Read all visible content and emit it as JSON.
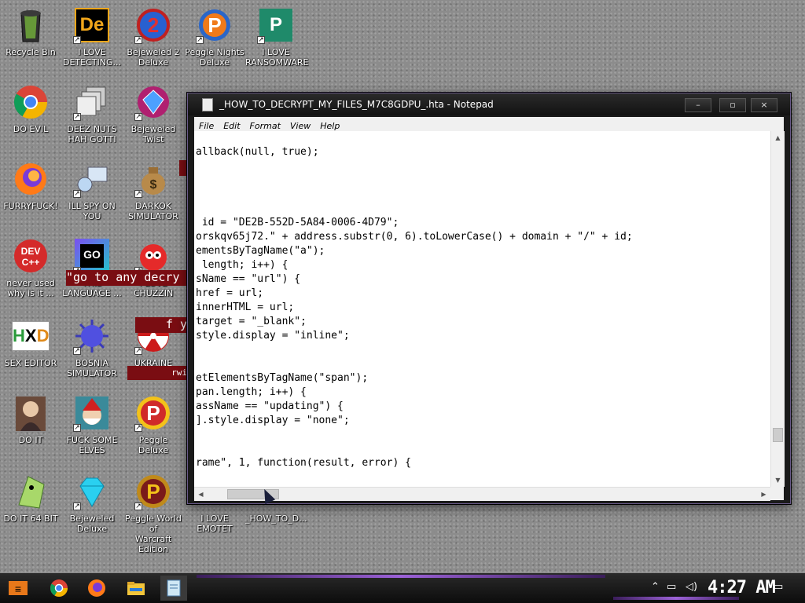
{
  "desktop": {
    "icons": [
      {
        "label": "Recycle Bin",
        "icon": "recycle-bin-icon"
      },
      {
        "label": "I LOVE\nDETECTING...",
        "icon": "de-app-icon"
      },
      {
        "label": "Bejeweled 2\nDeluxe",
        "icon": "bejeweled2-icon"
      },
      {
        "label": "Peggle Nights\nDeluxe",
        "icon": "peggle-nights-icon"
      },
      {
        "label": "I LOVE\nRANSOMWARE",
        "icon": "publisher-icon"
      },
      {
        "label": "DO EVIL",
        "icon": "chrome-icon"
      },
      {
        "label": "DEEZ NUTS\nHAH GOTTI",
        "icon": "windows-stack-icon"
      },
      {
        "label": "Bejeweled\nTwist",
        "icon": "bejeweled-twist-icon"
      },
      {
        "label": "FURRYFUCK!",
        "icon": "firefox-icon"
      },
      {
        "label": "ILL SPY ON\nYOU",
        "icon": "network-spy-icon"
      },
      {
        "label": "DARKOK\nSIMULATOR",
        "icon": "money-bag-icon"
      },
      {
        "label": "never used\nwhy is it ...",
        "icon": "devcpp-icon"
      },
      {
        "label": "THIS\nLANGUAGE ...",
        "icon": "goland-icon"
      },
      {
        "label": "I LOVE\nCHUZZIN",
        "icon": "chuzzle-icon"
      },
      {
        "label": "SEX EDITOR",
        "icon": "hxd-icon"
      },
      {
        "label": "BOSNIA\nSIMULATOR",
        "icon": "spiked-ball-icon"
      },
      {
        "label": "UKRAINE\nSIMULATOR",
        "icon": "radiation-icon"
      },
      {
        "label": "DO IT",
        "icon": "portrait-icon"
      },
      {
        "label": "FUCK SOME\nELVES",
        "icon": "santa-icon"
      },
      {
        "label": "Peggle Deluxe",
        "icon": "peggle-icon"
      },
      {
        "label": "DO IT 64 BIT",
        "icon": "gem-character-icon"
      },
      {
        "label": "Bejeweled\nDeluxe",
        "icon": "diamond-icon"
      },
      {
        "label": "Peggle World of\nWarcraft Edition",
        "icon": "peggle-wow-icon"
      },
      {
        "label": "I LOVE EMOTET",
        "icon": "blank-icon"
      },
      {
        "label": "_HOW_TO_D...",
        "icon": "blank-icon"
      }
    ],
    "overlay_strips": [
      "\"go to any decry",
      "f y",
      "rwi"
    ]
  },
  "notepad": {
    "title": "_HOW_TO_DECRYPT_MY_FILES_M7C8GDPU_.hta - Notepad",
    "controls": {
      "minimize": "–",
      "maximize": "▫",
      "close": "×"
    },
    "menu": [
      "File",
      "Edit",
      "Format",
      "View",
      "Help"
    ],
    "code_lines": [
      "allback(null, true);",
      "",
      "",
      "",
      "",
      " id = \"DE2B-552D-5A84-0006-4D79\";",
      "orskqv65j72.\" + address.substr(0, 6).toLowerCase() + domain + \"/\" + id;",
      "ementsByTagName(\"a\");",
      " length; i++) {",
      "sName == \"url\") {",
      "href = url;",
      "innerHTML = url;",
      "target = \"_blank\";",
      "style.display = \"inline\";",
      "",
      "",
      "etElementsByTagName(\"span\");",
      "pan.length; i++) {",
      "assName == \"updating\") {",
      "].style.display = \"none\";",
      "",
      "",
      "rame\", 1, function(result, error) {"
    ]
  },
  "taskbar": {
    "clock": "4:27 AM",
    "items": [
      "start-icon",
      "chrome-icon",
      "firefox-icon",
      "file-explorer-icon",
      "notepad-icon"
    ],
    "tray": [
      "chevron-up-icon",
      "network-icon",
      "volume-icon",
      "notification-icon"
    ]
  }
}
